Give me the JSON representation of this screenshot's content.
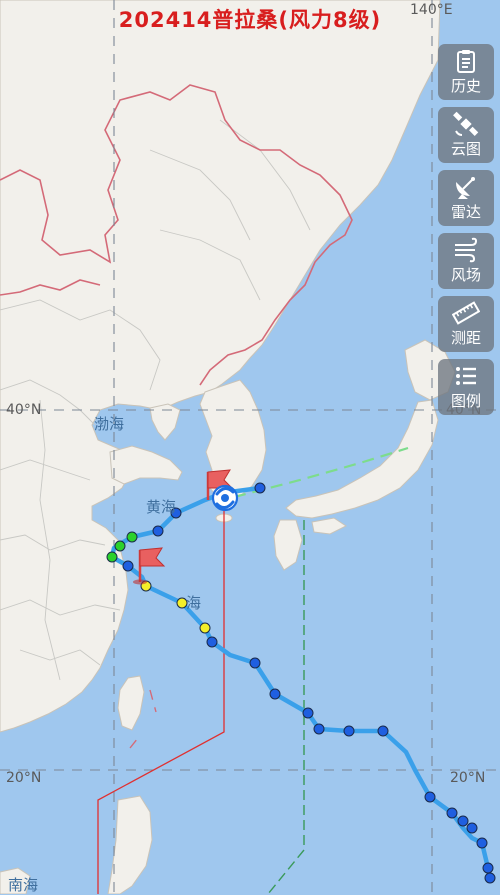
{
  "title": "202414普拉桑(风力8级)",
  "coords": {
    "lon_top": "140°E",
    "lat_40_left": "40°N",
    "lat_40_right": "40°N",
    "lat_20_left": "20°N",
    "lat_20_right": "20°N"
  },
  "seas": {
    "bohai": "渤海",
    "huanghai": "黄海",
    "donghai": "海",
    "nanhai": "南海"
  },
  "toolbar": [
    {
      "label": "历史",
      "icon": "clipboard-icon"
    },
    {
      "label": "云图",
      "icon": "satellite-icon"
    },
    {
      "label": "雷达",
      "icon": "radar-dish-icon"
    },
    {
      "label": "风场",
      "icon": "wind-icon"
    },
    {
      "label": "测距",
      "icon": "ruler-icon"
    },
    {
      "label": "图例",
      "icon": "list-icon"
    }
  ],
  "colors": {
    "title": "#d81e1e",
    "track": "#3aa0ea",
    "point_blue": "#1f5fe0",
    "point_yellow": "#f4ef2a",
    "point_green": "#2cd12c",
    "warning_24h": "#e03030",
    "warning_48h": "#3a9a5a",
    "land": "#f2f0eb",
    "sea": "#9fc7ee",
    "border": "#d46a78"
  }
}
